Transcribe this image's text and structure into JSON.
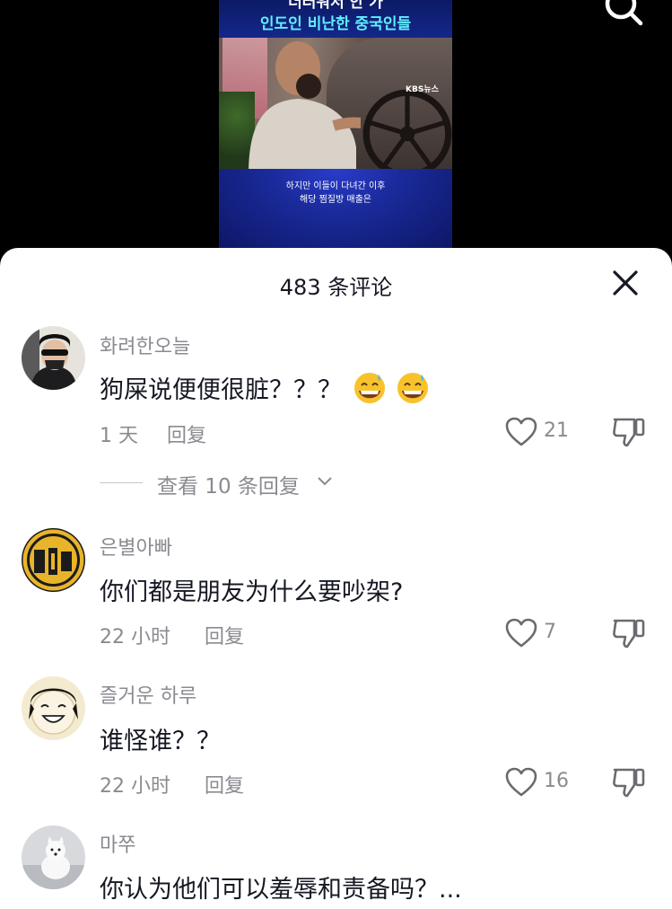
{
  "video": {
    "headline_top": "더러워서 안 가",
    "headline_main": "인도인 비난한 중국인들",
    "channel_logo": "KBS뉴스",
    "subtitle_line1": "하지만 이들이 다녀간 이후",
    "subtitle_line2": "해당 찜질방 매출은"
  },
  "sheet": {
    "title": "483 条评论",
    "close_icon": "close-icon"
  },
  "comments": [
    {
      "username": "화려한오늘",
      "text": "狗屎说便便很脏？？？",
      "emojis": [
        "grinning-sweat-emoji",
        "grinning-sweat-emoji"
      ],
      "time": "1 天",
      "reply_label": "回复",
      "likes": "21",
      "view_replies": "查看 10 条回复"
    },
    {
      "username": "은별아빠",
      "text": "你们都是朋友为什么要吵架?",
      "time": "22 小时",
      "reply_label": "回复",
      "likes": "7"
    },
    {
      "username": "즐거운 하루",
      "text": "谁怪谁？？",
      "time": "22 小时",
      "reply_label": "回复",
      "likes": "16"
    },
    {
      "username": "마쭈",
      "text": "你认为他们可以羞辱和责备吗？..."
    }
  ],
  "colors": {
    "text_primary": "#161823",
    "text_secondary": "#8a8b91",
    "sheet_bg": "#ffffff",
    "video_bg": "#000000"
  }
}
